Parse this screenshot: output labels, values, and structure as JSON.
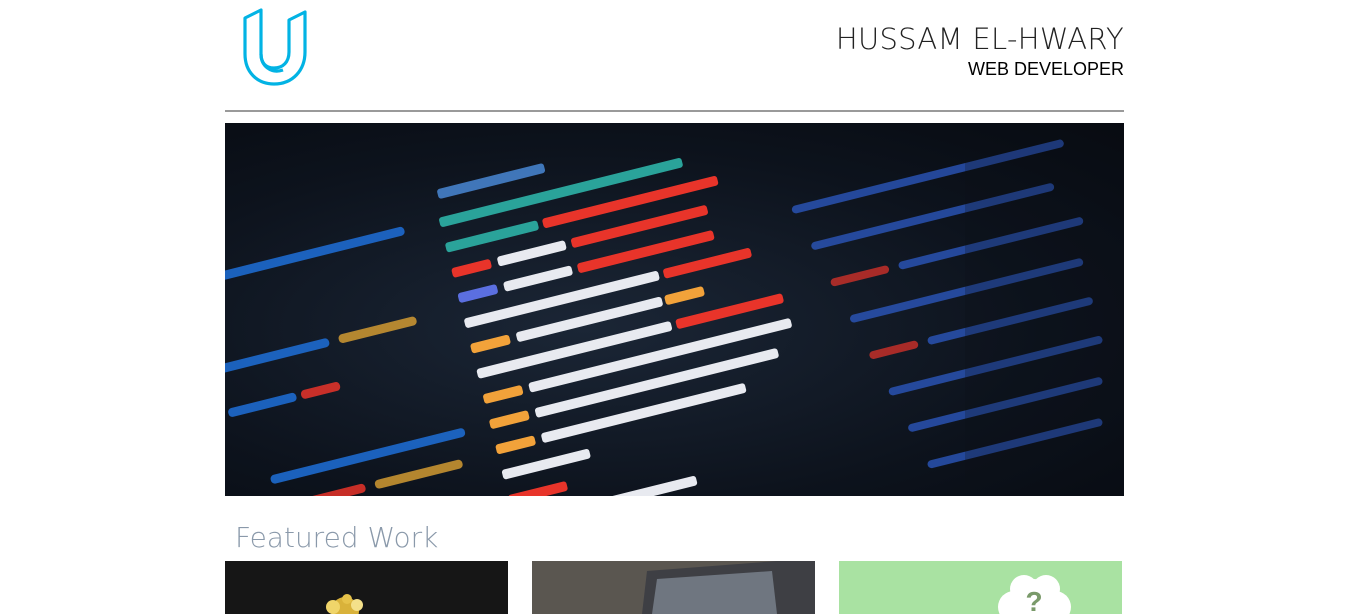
{
  "header": {
    "name": "HUSSAM EL-HWARY",
    "role": "WEB DEVELOPER",
    "logo_icon": "udacity-logo-icon",
    "logo_color": "#02b3e4"
  },
  "hero": {
    "description_icon": "code-screen-image"
  },
  "featured": {
    "heading": "Featured Work",
    "tiles": [
      {
        "icon": "golden-sculpture-image",
        "color": "#161616"
      },
      {
        "icon": "laptop-image",
        "color": "#5c5852"
      },
      {
        "icon": "question-cloud-image",
        "color": "#a9e2a2"
      }
    ]
  }
}
